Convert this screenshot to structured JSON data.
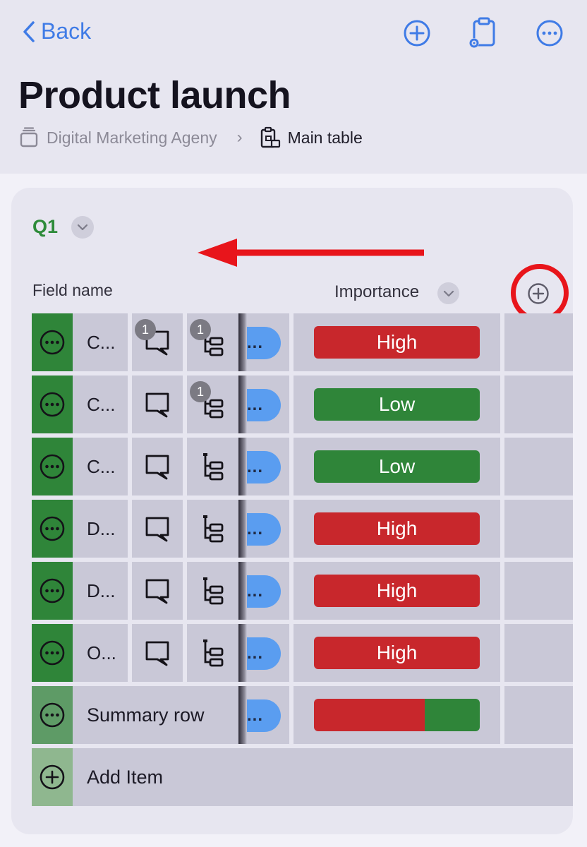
{
  "nav": {
    "back_label": "Back"
  },
  "board": {
    "title": "Product launch",
    "workspace": "Digital Marketing Ageny",
    "table": "Main table"
  },
  "group": {
    "label": "Q1",
    "label_color": "#2e8b3a"
  },
  "columns": {
    "field_name": "Field name",
    "importance": "Importance"
  },
  "colors": {
    "high": "#c8272c",
    "low": "#2f8539",
    "status": "#5a9df0",
    "accent": "#3f7be6",
    "annotation": "#e8151b"
  },
  "rows": [
    {
      "name": "C...",
      "status": "...",
      "updates": "1",
      "subitems": "1",
      "importance": "High"
    },
    {
      "name": "C...",
      "status": "...",
      "updates": "",
      "subitems": "1",
      "importance": "Low"
    },
    {
      "name": "C...",
      "status": "...",
      "updates": "",
      "subitems": "",
      "importance": "Low"
    },
    {
      "name": "D...",
      "status": "...",
      "updates": "",
      "subitems": "",
      "importance": "High"
    },
    {
      "name": "D...",
      "status": "...",
      "updates": "",
      "subitems": "",
      "importance": "High"
    },
    {
      "name": "O...",
      "status": "...",
      "updates": "",
      "subitems": "",
      "importance": "High"
    }
  ],
  "summary": {
    "label": "Summary row",
    "status": "...",
    "importance_high_fraction": 0.67
  },
  "add_item": {
    "label": "Add Item"
  }
}
